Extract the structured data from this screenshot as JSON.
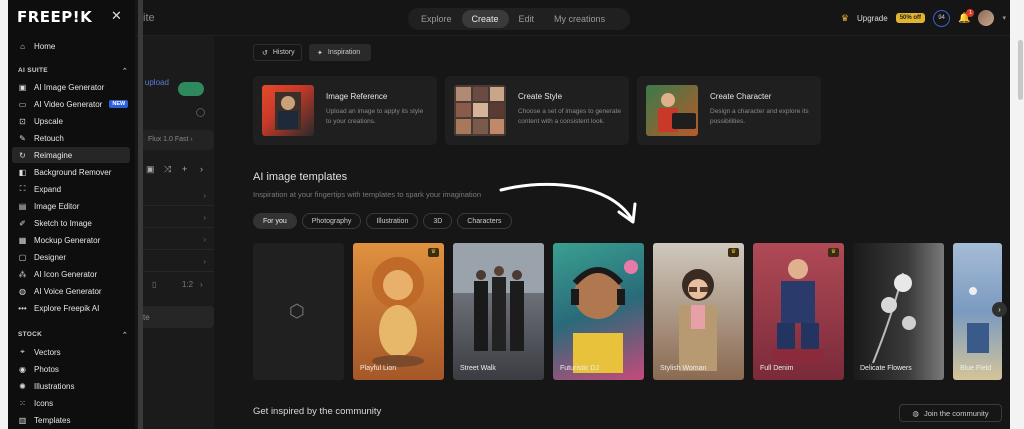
{
  "app": {
    "logo": "FREEP!K",
    "ghost_title": "ite",
    "nav_tabs": [
      "Explore",
      "Create",
      "Edit",
      "My creations"
    ],
    "active_tab": "Create",
    "upgrade_label": "Upgrade",
    "upgrade_badge": "50% off",
    "credits": "94",
    "notifications": "1"
  },
  "sidebar": {
    "home": "Home",
    "ai_suite_heading": "AI SUITE",
    "ai_items": [
      {
        "label": "AI Image Generator",
        "icon": "image-icon"
      },
      {
        "label": "AI Video Generator",
        "icon": "video-icon",
        "badge": "NEW"
      },
      {
        "label": "Upscale",
        "icon": "upscale-icon"
      },
      {
        "label": "Retouch",
        "icon": "brush-icon"
      },
      {
        "label": "Reimagine",
        "icon": "refresh-icon",
        "active": true
      },
      {
        "label": "Background Remover",
        "icon": "background-remover-icon"
      },
      {
        "label": "Expand",
        "icon": "expand-icon"
      },
      {
        "label": "Image Editor",
        "icon": "image-editor-icon"
      },
      {
        "label": "Sketch to Image",
        "icon": "pencil-icon"
      },
      {
        "label": "Mockup Generator",
        "icon": "mockup-icon"
      },
      {
        "label": "Designer",
        "icon": "designer-icon"
      },
      {
        "label": "AI Icon Generator",
        "icon": "icon-generator-icon"
      },
      {
        "label": "AI Voice Generator",
        "icon": "voice-icon"
      },
      {
        "label": "Explore Freepik AI",
        "icon": "more-icon"
      }
    ],
    "stock_heading": "STOCK",
    "stock_items": [
      {
        "label": "Vectors",
        "icon": "vector-icon"
      },
      {
        "label": "Photos",
        "icon": "camera-icon"
      },
      {
        "label": "Illustrations",
        "icon": "illustration-icon"
      },
      {
        "label": "Icons",
        "icon": "icons-icon"
      },
      {
        "label": "Templates",
        "icon": "template-icon"
      }
    ]
  },
  "left_panel": {
    "upload_text": "r upload",
    "model": "Flux 1.0 Fast",
    "ratio": "1:2",
    "bottom_button": "te"
  },
  "main": {
    "mode_tabs": [
      "History",
      "Inspiration"
    ],
    "cards": [
      {
        "title": "Image Reference",
        "desc": "Upload an image to apply its style to your creations."
      },
      {
        "title": "Create Style",
        "desc": "Choose a set of images to generate content with a consistent look."
      },
      {
        "title": "Create Character",
        "desc": "Design a character and explore its possibilities."
      }
    ],
    "templates_title": "AI image templates",
    "templates_subtitle": "Inspiration at your fingertips with templates to spark your imagination",
    "filters": [
      "For you",
      "Photography",
      "Illustration",
      "3D",
      "Characters"
    ],
    "tiles": [
      {
        "label": "Playful Lion",
        "color_top": "#d98a3a",
        "color_bottom": "#a8582a"
      },
      {
        "label": "Street Walk",
        "color_top": "#8a8f96",
        "color_bottom": "#3c3e44"
      },
      {
        "label": "Futuristic DJ",
        "color_top": "#3a9a8a",
        "color_bottom": "#c64a7a"
      },
      {
        "label": "Stylish Woman",
        "color_top": "#c8c2b8",
        "color_bottom": "#8a6a52"
      },
      {
        "label": "Full Denim",
        "color_top": "#b04a52",
        "color_bottom": "#2a3a6a"
      },
      {
        "label": "Delicate Flowers",
        "color_top": "#2a2a2a",
        "color_bottom": "#6a6a6a"
      },
      {
        "label": "Blue Field",
        "color_top": "#9ab4d4",
        "color_bottom": "#4a6a9a"
      }
    ],
    "community_title": "Get inspired by the community",
    "join_button": "Join the community"
  }
}
